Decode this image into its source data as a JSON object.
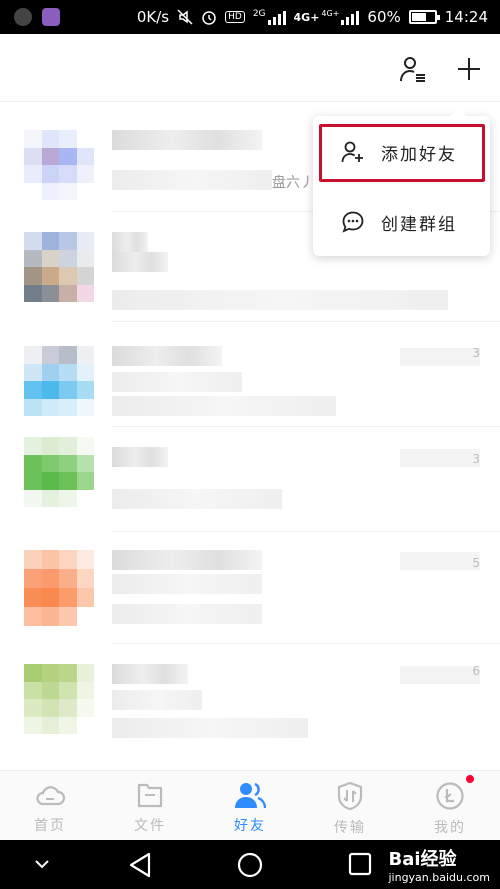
{
  "status_bar": {
    "network_speed": "0K/s",
    "badge_hd": "HD",
    "badge_2g": "2G",
    "badge_4g": "4G+",
    "badge_4g2": "4G+",
    "battery": "60%",
    "time": "14:24"
  },
  "header": {
    "icons": [
      "contacts-manage-icon",
      "plus-icon"
    ]
  },
  "popup_menu": {
    "items": [
      {
        "label": "添加好友",
        "icon": "add-friend-icon"
      },
      {
        "label": "创建群组",
        "icon": "chat-bubble-icon"
      }
    ]
  },
  "list_overlap_text": "盘六丿",
  "right_digits": [
    "3",
    "3",
    "5",
    "6"
  ],
  "bottom_nav": {
    "items": [
      {
        "label": "首页",
        "icon": "cloud-icon",
        "active": false
      },
      {
        "label": "文件",
        "icon": "folder-icon",
        "active": false
      },
      {
        "label": "好友",
        "icon": "friends-icon",
        "active": true
      },
      {
        "label": "传输",
        "icon": "transfer-shield-icon",
        "active": false
      },
      {
        "label": "我的",
        "icon": "profile-coin-icon",
        "active": false,
        "badge": true
      }
    ]
  },
  "watermark": {
    "brand": "Bai经验",
    "url": "jingyan.baidu.com"
  },
  "colors": {
    "accent": "#2e8cff",
    "highlight": "#c8102e",
    "badge": "#ff0033"
  }
}
